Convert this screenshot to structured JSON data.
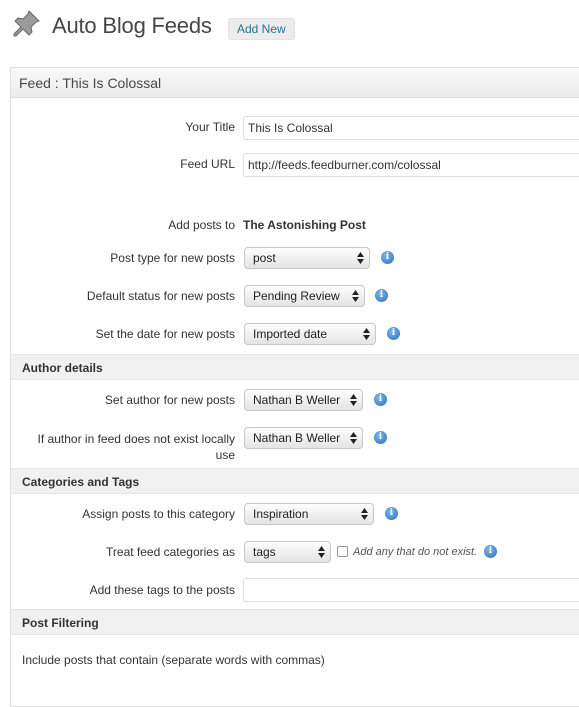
{
  "header": {
    "title": "Auto Blog Feeds",
    "add_new_label": "Add New",
    "icon": "pushpin-icon"
  },
  "panel": {
    "title": "Feed : This Is Colossal"
  },
  "form": {
    "your_title": {
      "label": "Your Title",
      "value": "This Is Colossal"
    },
    "feed_url": {
      "label": "Feed URL",
      "value": "http://feeds.feedburner.com/colossal"
    },
    "add_posts_to": {
      "label": "Add posts to",
      "value": "The Astonishing Post"
    },
    "post_type": {
      "label": "Post type for new posts",
      "value": "post"
    },
    "default_status": {
      "label": "Default status for new posts",
      "value": "Pending Review"
    },
    "set_date": {
      "label": "Set the date for new posts",
      "value": "Imported date"
    }
  },
  "author": {
    "section_title": "Author details",
    "set_author": {
      "label": "Set author for new posts",
      "value": "Nathan B Weller"
    },
    "if_missing": {
      "label_line1": "If author in feed does not exist locally",
      "label_line2": "use",
      "value": "Nathan B Weller"
    }
  },
  "categories": {
    "section_title": "Categories and Tags",
    "assign_category": {
      "label": "Assign posts to this category",
      "value": "Inspiration"
    },
    "treat_feed_categories": {
      "label": "Treat feed categories as",
      "value": "tags",
      "checkbox_label": "Add any that do not exist.",
      "checked": false
    },
    "add_tags": {
      "label": "Add these tags to the posts",
      "value": ""
    }
  },
  "filtering": {
    "section_title": "Post Filtering",
    "include_label": "Include posts that contain (separate words with commas)"
  },
  "info_glyph": "i"
}
